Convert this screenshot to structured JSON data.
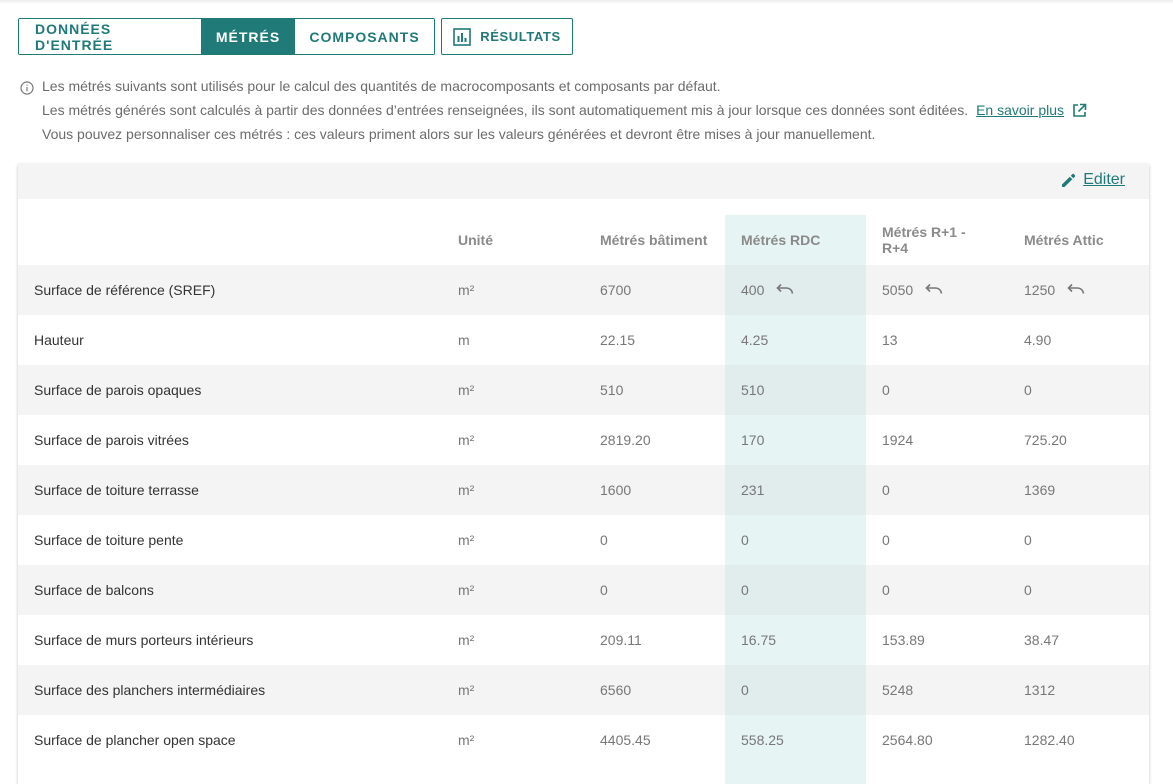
{
  "tabs": [
    {
      "label": "DONNÉES D'ENTRÉE",
      "active": false
    },
    {
      "label": "MÉTRÉS",
      "active": true
    },
    {
      "label": "COMPOSANTS",
      "active": false
    }
  ],
  "results_button": {
    "label": "RÉSULTATS",
    "icon": "bar-chart-icon"
  },
  "info": {
    "icon": "info-icon",
    "line1": "Les métrés suivants sont utilisés pour le calcul des quantités de macrocomposants et composants par défaut.",
    "line2": "Les métrés générés sont calculés à partir des données d’entrées renseignées, ils sont automatiquement mis à jour lorsque ces données sont éditées.",
    "learn_more": "En savoir plus",
    "line3": "Vous pouvez personnaliser ces métrés : ces valeurs priment alors sur les valeurs générées et devront être mises à jour manuellement."
  },
  "edit_link": {
    "label": "Editer",
    "icon": "pencil-icon"
  },
  "accent_color": "#1f7a78",
  "table": {
    "headers": {
      "label": "",
      "unit": "Unité",
      "batiment": "Métrés bâtiment",
      "rdc": "Métrés RDC",
      "r14": "Métrés R+1 - R+4",
      "attic": "Métrés Attic"
    },
    "rows": [
      {
        "label": "Surface de référence (SREF)",
        "unit": "m²",
        "batiment": "6700",
        "rdc": "400",
        "r14": "5050",
        "attic": "1250",
        "customized": true
      },
      {
        "label": "Hauteur",
        "unit": "m",
        "batiment": "22.15",
        "rdc": "4.25",
        "r14": "13",
        "attic": "4.90",
        "customized": false
      },
      {
        "label": "Surface de parois opaques",
        "unit": "m²",
        "batiment": "510",
        "rdc": "510",
        "r14": "0",
        "attic": "0",
        "customized": false
      },
      {
        "label": "Surface de parois vitrées",
        "unit": "m²",
        "batiment": "2819.20",
        "rdc": "170",
        "r14": "1924",
        "attic": "725.20",
        "customized": false
      },
      {
        "label": "Surface de toiture terrasse",
        "unit": "m²",
        "batiment": "1600",
        "rdc": "231",
        "r14": "0",
        "attic": "1369",
        "customized": false
      },
      {
        "label": "Surface de toiture pente",
        "unit": "m²",
        "batiment": "0",
        "rdc": "0",
        "r14": "0",
        "attic": "0",
        "customized": false
      },
      {
        "label": "Surface de balcons",
        "unit": "m²",
        "batiment": "0",
        "rdc": "0",
        "r14": "0",
        "attic": "0",
        "customized": false
      },
      {
        "label": "Surface de murs porteurs intérieurs",
        "unit": "m²",
        "batiment": "209.11",
        "rdc": "16.75",
        "r14": "153.89",
        "attic": "38.47",
        "customized": false
      },
      {
        "label": "Surface des planchers intermédiaires",
        "unit": "m²",
        "batiment": "6560",
        "rdc": "0",
        "r14": "5248",
        "attic": "1312",
        "customized": false
      },
      {
        "label": "Surface de plancher open space",
        "unit": "m²",
        "batiment": "4405.45",
        "rdc": "558.25",
        "r14": "2564.80",
        "attic": "1282.40",
        "customized": false
      }
    ]
  }
}
